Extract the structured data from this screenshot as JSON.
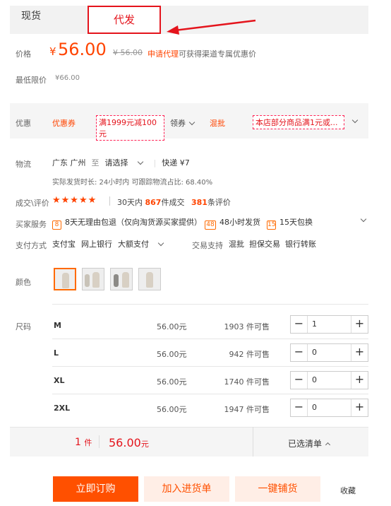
{
  "tabs": {
    "spot": "现货",
    "daifa": "代发"
  },
  "price": {
    "label": "价格",
    "currency": "¥",
    "value": "56.00",
    "old": "¥ 56.00",
    "agent_link": "申请代理",
    "agent_text": "可获得渠道专属优惠价",
    "min_label": "最低限价",
    "min_value": "¥66.00"
  },
  "promo": {
    "label": "优惠",
    "coupon_title": "优惠券",
    "coupon_tag": "满1999元减100元",
    "get_coupon": "领券",
    "mix_title": "混批",
    "mix_tag": "本店部分商品满1元或..."
  },
  "logistics": {
    "label": "物流",
    "from": "广东 广州",
    "to": "至",
    "select": "请选择",
    "express": "快递 ¥7",
    "sub": "实际发货时长: 24小时内   可跟踪物流占比: 68.40%"
  },
  "deal": {
    "label": "成交\\评价",
    "stars": "★★★★★",
    "days": "30天内",
    "count": "867",
    "count_suffix": "件成交",
    "reviews": "381",
    "reviews_suffix": "条评价"
  },
  "services": {
    "label": "买家服务",
    "items": [
      {
        "icon": "8",
        "text": "8天无理由包退（仅向淘货源买家提供）"
      },
      {
        "icon": "48",
        "text": "48小时发货"
      },
      {
        "icon": "15",
        "text": "15天包换"
      }
    ]
  },
  "payment": {
    "label": "支付方式",
    "methods": [
      "支付宝",
      "网上银行",
      "大额支付"
    ],
    "trade_label": "交易支持",
    "trade": [
      "混批",
      "担保交易",
      "银行转账"
    ]
  },
  "color": {
    "label": "颜色"
  },
  "sizes": {
    "label": "尺码",
    "rows": [
      {
        "size": "M",
        "price": "56.00元",
        "stock": "1903 件可售",
        "qty": "1"
      },
      {
        "size": "L",
        "price": "56.00元",
        "stock": "942 件可售",
        "qty": "0"
      },
      {
        "size": "XL",
        "price": "56.00元",
        "stock": "1740 件可售",
        "qty": "0"
      },
      {
        "size": "2XL",
        "price": "56.00元",
        "stock": "1947 件可售",
        "qty": "0"
      }
    ]
  },
  "summary": {
    "count": "1",
    "count_unit": "件",
    "price": "56.00",
    "price_unit": "元",
    "list": "已选清单"
  },
  "actions": {
    "buy": "立即订购",
    "add": "加入进货单",
    "distribute": "一键铺货",
    "favorite": "收藏"
  },
  "colors": {
    "accent": "#ff4400",
    "tab_border": "#e4141c"
  }
}
